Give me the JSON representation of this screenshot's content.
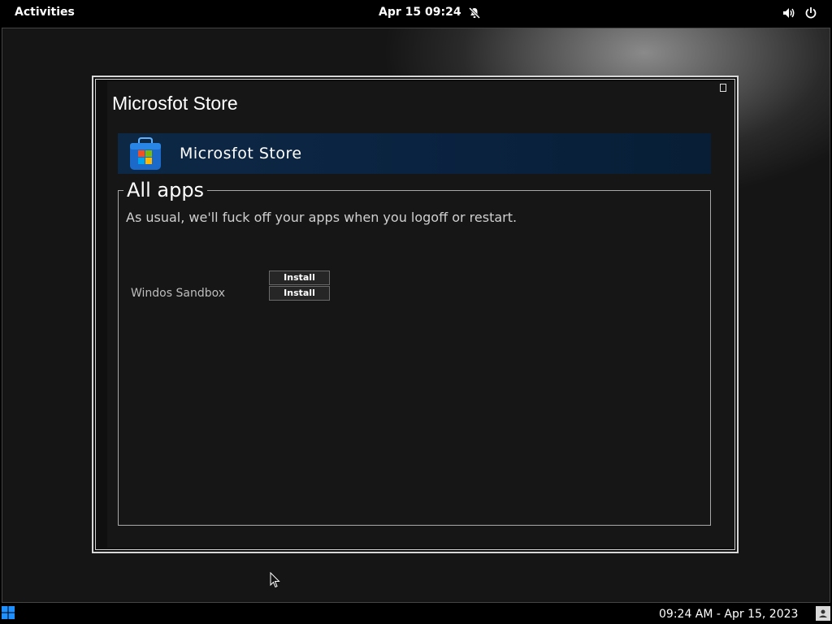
{
  "topbar": {
    "activities_label": "Activities",
    "clock": "Apr 15  09:24",
    "icons": [
      "bell-muted-icon",
      "volume-icon",
      "power-icon"
    ]
  },
  "window": {
    "title": "Microsfot Store",
    "header_title": "Microsfot Store",
    "group_label": "All apps",
    "description": "As usual, we'll fuck off your apps when you logoff or restart.",
    "apps": [
      {
        "name": "Windos Sandbox",
        "buttons": [
          "Install",
          "Install"
        ]
      }
    ]
  },
  "taskbar": {
    "clock": "09:24 AM - Apr 15, 2023"
  },
  "colors": {
    "header_bar": "#0a2340",
    "window_bg": "#161616",
    "accent_blue": "#1e6fd0"
  }
}
